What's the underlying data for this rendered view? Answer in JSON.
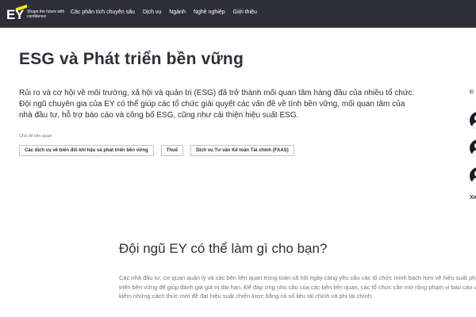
{
  "header": {
    "logo_text": "EY",
    "logo_tagline": "Shape the future with confidence",
    "nav": [
      "Các phân tích chuyên sâu",
      "Dịch vụ",
      "Ngành",
      "Nghề nghiệp",
      "Giới thiệu"
    ],
    "colors": {
      "bar": "#2e2e38",
      "accent": "#ffe600"
    }
  },
  "main": {
    "title": "ESG và Phát triển bền vững",
    "intro": "Rủi ro và cơ hội về môi trường, xã hội và quản trị (ESG) đã trở thành mối quan tâm hàng đầu của nhiều tổ chức. Đội ngũ chuyên gia của EY có thể giúp các tổ chức giải quyết các vấn đề về tính bền vững, mối quan tâm của nhà đầu tư, hỗ trợ báo cáo và công bố ESG, cũng như cải thiện hiệu suất ESG.",
    "related_label": "Chủ đề liên quan",
    "related_topics": [
      "Các dịch vụ về biến đổi khí hậu và phát triển bền vững",
      "Thuế",
      "Dịch vụ Tư vấn Kế toán Tài chính (FAAS)"
    ]
  },
  "rail": {
    "label": "Đ",
    "more": "Xe"
  },
  "section": {
    "title": "Đội ngũ EY có thể làm gì cho bạn?",
    "body": "Các nhà đầu tư, cơ quan quản lý và các bên liên quan trong toàn xã hội ngày càng yêu cầu các tổ chức minh bạch hơn về hiệu suất phát triển bền vững để giúp đánh giá giá trị dài hạn. Để đáp ứng nhu cầu của các bên liên quan, các tổ chức cần mở rộng phạm vi báo cáo và tìm kiếm những cách thức mới để đạt hiệu suất chiến lược bằng cả số liệu tài chính và phi tài chính."
  }
}
